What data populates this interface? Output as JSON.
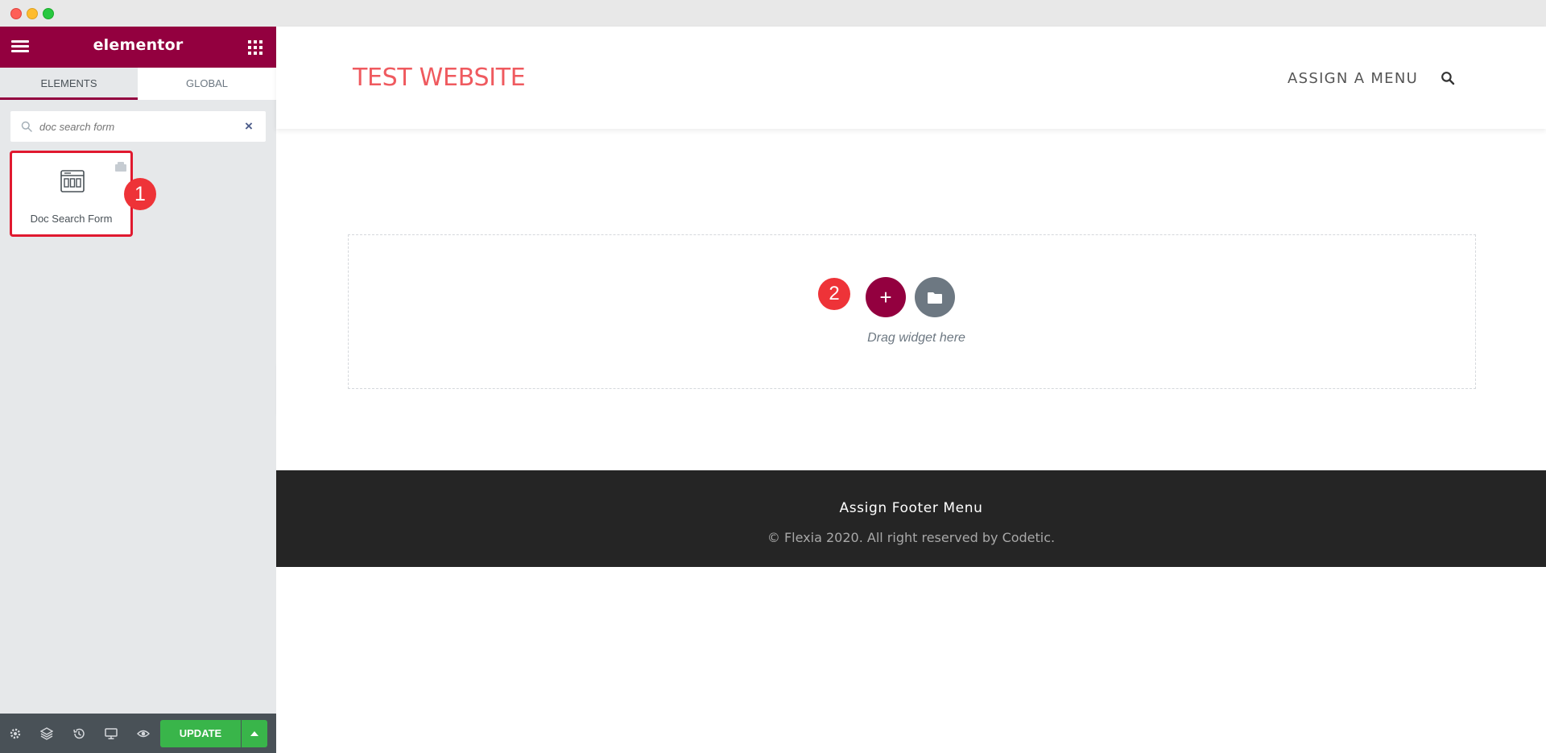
{
  "window": {
    "controls": [
      "close",
      "minimize",
      "zoom"
    ]
  },
  "panel": {
    "brand": "elementor",
    "tabs": [
      {
        "label": "ELEMENTS",
        "active": true
      },
      {
        "label": "GLOBAL",
        "active": false
      }
    ],
    "search": {
      "value": "",
      "placeholder": "doc search form"
    },
    "widgets": [
      {
        "label": "Doc Search Form",
        "icon": "doc-search-form-icon"
      }
    ],
    "bottom_bar": {
      "icons": [
        "settings-icon",
        "navigator-icon",
        "history-icon",
        "responsive-icon",
        "preview-icon"
      ],
      "update_label": "UPDATE"
    }
  },
  "annotations": {
    "step1": "1",
    "step2": "2"
  },
  "preview": {
    "site_title": "TEST WEBSITE",
    "nav_label": "ASSIGN A MENU",
    "drop_zone_text": "Drag widget here",
    "add_label": "+",
    "footer": {
      "menu": "Assign Footer Menu",
      "copyright": "© Flexia 2020. All right reserved by Codetic."
    }
  },
  "colors": {
    "brand": "#93003f",
    "update": "#39b54a",
    "site_title": "#ef5a5f",
    "annotation": "#ee3338",
    "footer_bg": "#252525"
  }
}
